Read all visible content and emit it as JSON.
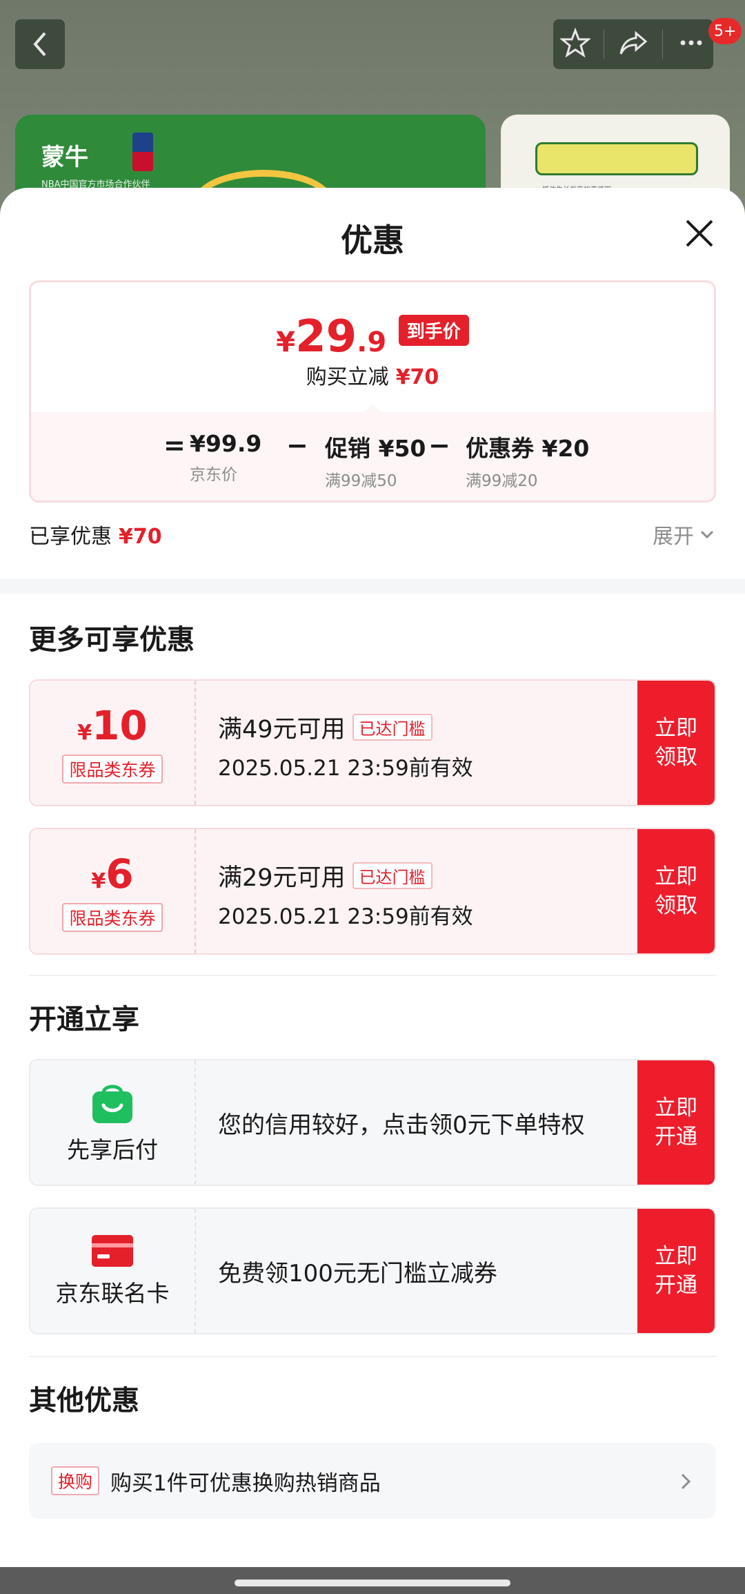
{
  "status_bar": {
    "message_badge": "5+"
  },
  "background": {
    "banner_brand": "蒙牛",
    "banner_sub": "NBA中国官方市场合作伙伴",
    "banner_right_slogan": "抓住生长发育的高峰期"
  },
  "sheet": {
    "title": "优惠"
  },
  "price": {
    "yen": "¥",
    "integer": "29",
    "decimal": ".9",
    "tag": "到手价",
    "saving_label": "购买立减",
    "saving_value": "¥70",
    "breakdown": {
      "equals": "=",
      "minus": "−",
      "jd_price": "¥99.9",
      "jd_price_label": "京东价",
      "promo": "促销 ¥50",
      "promo_rule": "满99减50",
      "coupon": "优惠券 ¥20",
      "coupon_rule": "满99减20"
    }
  },
  "enjoyed": {
    "label": "已享优惠",
    "value": "¥70",
    "expand": "展开"
  },
  "more_offers": {
    "title": "更多可享优惠",
    "coupons": [
      {
        "yen": "¥",
        "amount": "10",
        "type": "限品类东券",
        "condition": "满49元可用",
        "badge": "已达门槛",
        "validity": "2025.05.21 23:59前有效",
        "button": "立即\n领取"
      },
      {
        "yen": "¥",
        "amount": "6",
        "type": "限品类东券",
        "condition": "满29元可用",
        "badge": "已达门槛",
        "validity": "2025.05.21 23:59前有效",
        "button": "立即\n领取"
      }
    ]
  },
  "activate": {
    "title": "开通立享",
    "services": [
      {
        "name": "先享后付",
        "icon": "shopping-bag-icon",
        "color": "#1fbf5f",
        "desc": "您的信用较好，点击领0元下单特权",
        "button": "立即\n开通"
      },
      {
        "name": "京东联名卡",
        "icon": "credit-card-icon",
        "color": "#e4202a",
        "desc": "免费领100元无门槛立减券",
        "button": "立即\n开通"
      }
    ]
  },
  "other": {
    "title": "其他优惠",
    "tag": "换购",
    "text": "购买1件可优惠换购热销商品"
  },
  "colors": {
    "accent": "#e4202a",
    "button": "#ee1d2c"
  }
}
